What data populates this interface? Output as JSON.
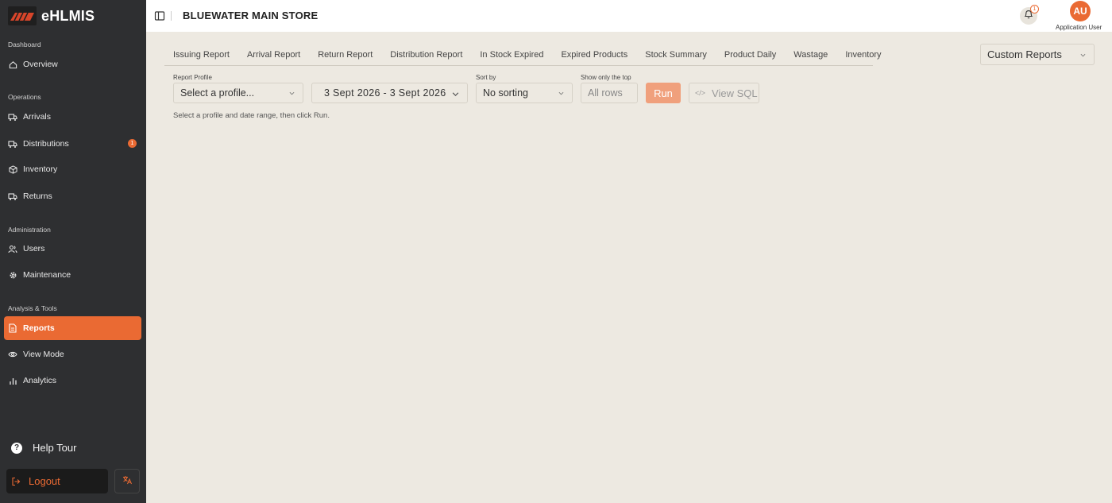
{
  "app": {
    "name": "eHLMIS"
  },
  "sidebar": {
    "sections": [
      {
        "label": "Dashboard"
      },
      {
        "label": "Operations"
      },
      {
        "label": "Administration"
      },
      {
        "label": "Analysis & Tools"
      }
    ],
    "items": [
      {
        "label": "Overview",
        "icon": "home-icon"
      },
      {
        "label": "Arrivals",
        "icon": "truck-icon"
      },
      {
        "label": "Distributions",
        "icon": "truck-out-icon",
        "badge": "1"
      },
      {
        "label": "Inventory",
        "icon": "box-icon"
      },
      {
        "label": "Returns",
        "icon": "return-truck-icon"
      },
      {
        "label": "Users",
        "icon": "users-icon"
      },
      {
        "label": "Maintenance",
        "icon": "gear-icon"
      },
      {
        "label": "Reports",
        "icon": "report-icon",
        "active": true
      },
      {
        "label": "View Mode",
        "icon": "eye-icon"
      },
      {
        "label": "Analytics",
        "icon": "bar-chart-icon"
      }
    ],
    "help_tour": "Help Tour",
    "logout": "Logout"
  },
  "header": {
    "store_title": "BLUEWATER MAIN STORE",
    "notifications_count": "1",
    "avatar_initials": "AU",
    "user_name": "Application User"
  },
  "tabs": [
    {
      "label": "Issuing Report"
    },
    {
      "label": "Arrival Report"
    },
    {
      "label": "Return Report"
    },
    {
      "label": "Distribution Report"
    },
    {
      "label": "In Stock Expired"
    },
    {
      "label": "Expired Products"
    },
    {
      "label": "Stock Summary"
    },
    {
      "label": "Product Daily"
    },
    {
      "label": "Wastage"
    },
    {
      "label": "Inventory"
    }
  ],
  "custom_reports": {
    "label": "Custom Reports"
  },
  "filters": {
    "profile": {
      "label": "Report Profile",
      "placeholder": "Select a profile..."
    },
    "date_range": {
      "value": "3 Sept 2026 - 3 Sept 2026"
    },
    "sort": {
      "label": "Sort by",
      "value": "No sorting"
    },
    "top": {
      "label": "Show only the top",
      "placeholder": "All rows"
    },
    "run_label": "Run",
    "view_sql_label": "View SQL"
  },
  "hint": "Select a profile and date range, then click Run.",
  "colors": {
    "accent": "#ea6a33",
    "sidebar_bg": "#2e2f31",
    "page_bg": "#ede9e1"
  }
}
